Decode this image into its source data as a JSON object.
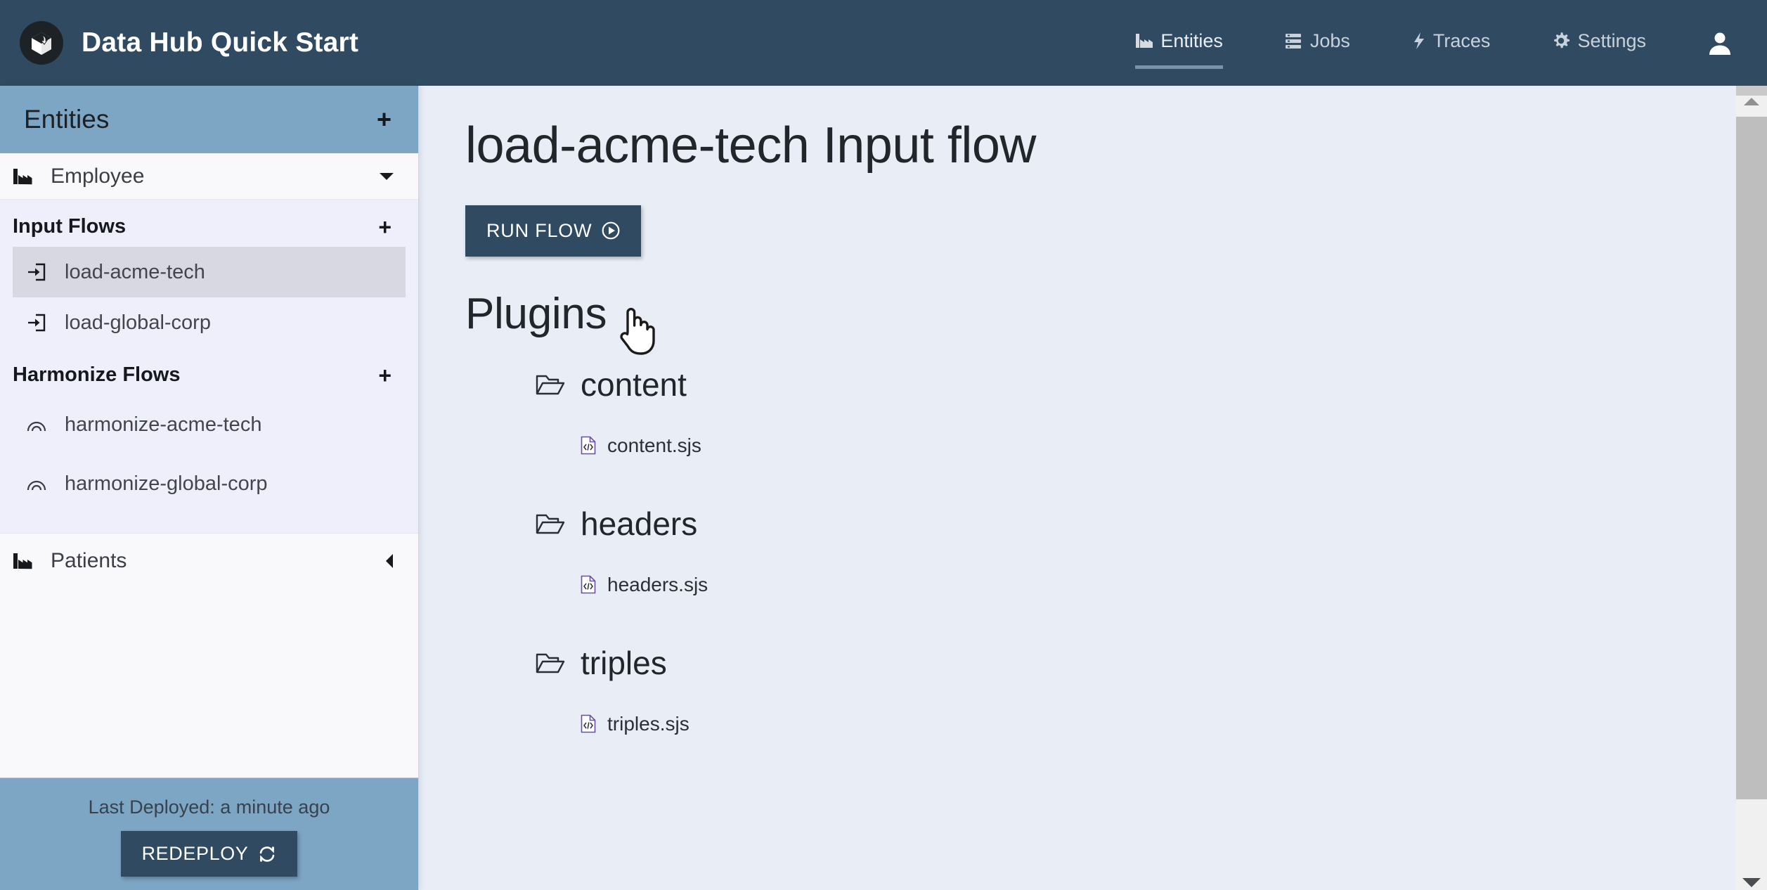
{
  "app": {
    "title": "Data Hub Quick Start",
    "logo_icon": "cube-logo-icon",
    "accent_dark": "#2f4a61",
    "accent_blue": "#7da5c4",
    "main_bg": "#e8edf6"
  },
  "topnav": {
    "items": [
      {
        "label": "Entities",
        "icon": "factory-icon",
        "active": true
      },
      {
        "label": "Jobs",
        "icon": "list-icon",
        "active": false
      },
      {
        "label": "Traces",
        "icon": "bolt-icon",
        "active": false
      },
      {
        "label": "Settings",
        "icon": "gear-icon",
        "active": false
      }
    ],
    "avatar_icon": "user-icon"
  },
  "sidebar": {
    "header": {
      "title": "Entities",
      "add_label": "+"
    },
    "entities": [
      {
        "label": "Employee",
        "icon": "factory-icon",
        "caret": "chevron-down-icon",
        "expanded": true
      },
      {
        "label": "Patients",
        "icon": "factory-icon",
        "caret": "chevron-left-icon",
        "expanded": false
      }
    ],
    "groups": [
      {
        "title": "Input Flows",
        "add_label": "+",
        "items": [
          {
            "label": "load-acme-tech",
            "icon": "sign-in-icon",
            "selected": true
          },
          {
            "label": "load-global-corp",
            "icon": "sign-in-icon",
            "selected": false
          }
        ]
      },
      {
        "title": "Harmonize Flows",
        "add_label": "+",
        "items": [
          {
            "label": "harmonize-acme-tech",
            "icon": "arc-icon",
            "selected": false
          },
          {
            "label": "harmonize-global-corp",
            "icon": "arc-icon",
            "selected": false
          }
        ]
      }
    ],
    "deploy": {
      "status": "Last Deployed: a minute ago",
      "button_label": "REDEPLOY",
      "button_icon": "refresh-icon"
    }
  },
  "main": {
    "page_title": "load-acme-tech Input flow",
    "run_flow": {
      "label": "RUN FLOW",
      "icon": "play-circle-icon"
    },
    "plugins_heading": "Plugins",
    "tree": [
      {
        "folder": "content",
        "folder_icon": "folder-open-icon",
        "files": [
          {
            "name": "content.sjs",
            "icon": "code-file-icon"
          }
        ]
      },
      {
        "folder": "headers",
        "folder_icon": "folder-open-icon",
        "files": [
          {
            "name": "headers.sjs",
            "icon": "code-file-icon"
          }
        ]
      },
      {
        "folder": "triples",
        "folder_icon": "folder-open-icon",
        "files": [
          {
            "name": "triples.sjs",
            "icon": "code-file-icon"
          }
        ]
      }
    ]
  },
  "scrollbar": {
    "up_icon": "triangle-up-icon",
    "down_icon": "triangle-down-icon"
  },
  "cursor": {
    "type": "pointer-hand-cursor"
  }
}
